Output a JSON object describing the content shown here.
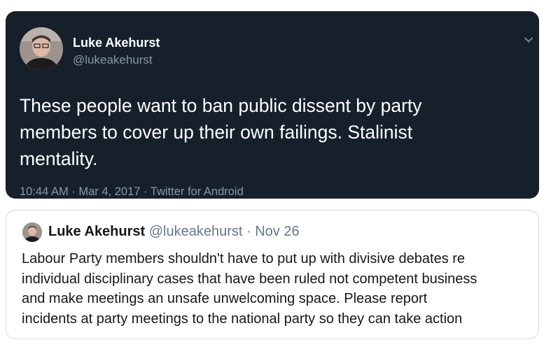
{
  "tweet": {
    "author_name": "Luke Akehurst",
    "author_handle": "@lukeakehurst",
    "text_lines": [
      "These people want to ban public dissent by party",
      "members  to cover up their own failings. Stalinist",
      "mentality."
    ],
    "meta": "10:44 AM · Mar 4, 2017 · Twitter for Android",
    "avatar_icon": "user-photo-avatar",
    "menu_icon": "chevron-down-icon",
    "colors": {
      "background": "#15202b",
      "text": "#ffffff",
      "secondary": "#8899a6"
    }
  },
  "quoted_tweet": {
    "author_name": "Luke Akehurst",
    "author_handle": "@lukeakehurst",
    "separator": " · ",
    "date": "Nov 26",
    "text_lines": [
      "Labour Party members shouldn't have to put up with divisive  debates re",
      "individual disciplinary cases that have been ruled not competent business",
      "and make meetings an unsafe unwelcoming space. Please report",
      "incidents at party meetings to the national party so they can take action"
    ],
    "avatar_icon": "user-photo-avatar",
    "colors": {
      "border": "#cfd9de",
      "text": "#14171a",
      "secondary": "#657786"
    }
  }
}
